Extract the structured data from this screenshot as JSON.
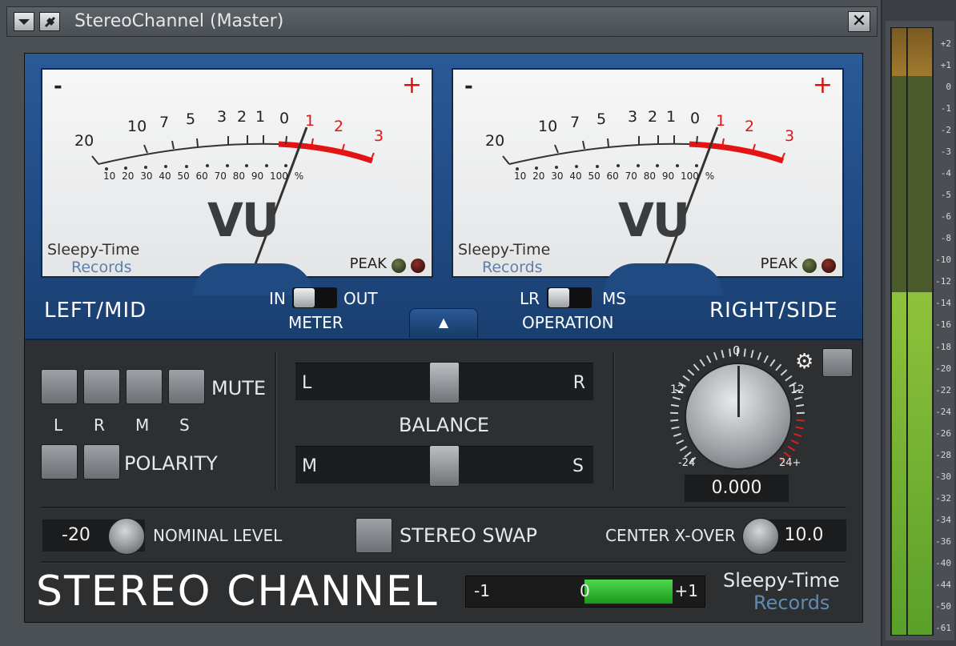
{
  "window": {
    "title": "StereoChannel (Master)",
    "close": "✕"
  },
  "meters": [
    {
      "minus": "-",
      "plus": "+",
      "vu": "VU",
      "brand_line1": "Sleepy-Time",
      "brand_line2": "Records",
      "peak": "PEAK"
    },
    {
      "minus": "-",
      "plus": "+",
      "vu": "VU",
      "brand_line1": "Sleepy-Time",
      "brand_line2": "Records",
      "peak": "PEAK"
    }
  ],
  "vu_scale": {
    "top": [
      "20",
      "10",
      "7",
      "5",
      "3",
      "2",
      "1",
      "0",
      "1",
      "2",
      "3"
    ],
    "percent": [
      "10",
      "20",
      "30",
      "40",
      "50",
      "60",
      "70",
      "80",
      "90",
      "100",
      "%"
    ]
  },
  "labels": {
    "left_mid": "LEFT/MID",
    "right_side": "RIGHT/SIDE",
    "meter": {
      "in": "IN",
      "out": "OUT",
      "title": "METER"
    },
    "operation": {
      "lr": "LR",
      "ms": "MS",
      "title": "OPERATION"
    },
    "up_arrow": "▲"
  },
  "mute": {
    "label": "MUTE",
    "buttons": [
      "L",
      "R",
      "M",
      "S"
    ]
  },
  "polarity": {
    "label": "POLARITY"
  },
  "balance": {
    "label": "BALANCE",
    "left": "L",
    "right": "R",
    "m": "M",
    "s": "S"
  },
  "gain": {
    "top": "0",
    "left": "12",
    "right": "12",
    "bl": "-24",
    "br": "24+",
    "value": "0.000",
    "gear": "⚙"
  },
  "nominal": {
    "value": "-20",
    "label": "NOMINAL LEVEL"
  },
  "stereo_swap": {
    "label": "STEREO SWAP"
  },
  "center_xover": {
    "label": "CENTER X-OVER",
    "value": "10.0"
  },
  "footer": {
    "title": "STEREO CHANNEL",
    "bal_minus": "-1",
    "bal_zero": "0",
    "bal_plus": "+1",
    "brand1": "Sleepy-Time",
    "brand2": "Records"
  },
  "strip_scale": [
    "+2",
    "+1",
    "0",
    "-1",
    "-2",
    "-3",
    "-4",
    "-5",
    "-6",
    "-8",
    "-10",
    "-12",
    "-14",
    "-16",
    "-18",
    "-20",
    "-22",
    "-24",
    "-26",
    "-28",
    "-30",
    "-32",
    "-34",
    "-36",
    "-40",
    "-44",
    "-50",
    "-61"
  ]
}
